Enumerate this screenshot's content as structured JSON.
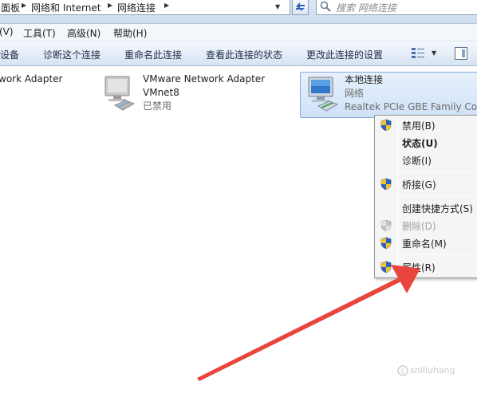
{
  "address_bar": {
    "crumbs": [
      "面板",
      "网络和 Internet",
      "网络连接"
    ],
    "search_placeholder": "搜索 网络连接"
  },
  "menu_bar": {
    "items": [
      "(V)",
      "工具(T)",
      "高级(N)",
      "帮助(H)"
    ]
  },
  "command_bar": {
    "items": [
      "设备",
      "诊断这个连接",
      "重命名此连接",
      "查看此连接的状态",
      "更改此连接的设置"
    ]
  },
  "adapters": [
    {
      "name": "work Adapter",
      "line2": "",
      "line3": ""
    },
    {
      "name": "VMware Network Adapter",
      "line2": "VMnet8",
      "line3": "已禁用"
    },
    {
      "name": "本地连接",
      "line2": "网络",
      "line3": "Realtek PCIe GBE Family Con"
    }
  ],
  "context_menu": {
    "items": [
      {
        "label": "禁用(B)",
        "icon": "shield-icon",
        "style": "normal"
      },
      {
        "label": "状态(U)",
        "icon": "",
        "style": "bold"
      },
      {
        "label": "诊断(I)",
        "icon": "",
        "style": "normal"
      },
      {
        "label": "桥接(G)",
        "icon": "shield-icon",
        "style": "normal"
      },
      {
        "label": "创建快捷方式(S)",
        "icon": "",
        "style": "normal"
      },
      {
        "label": "删除(D)",
        "icon": "shield-icon",
        "style": "disabled"
      },
      {
        "label": "重命名(M)",
        "icon": "shield-icon",
        "style": "normal"
      },
      {
        "label": "属性(R)",
        "icon": "shield-icon",
        "style": "normal"
      }
    ]
  },
  "annotation": {
    "color": "#e8453c"
  },
  "watermark": {
    "text": "shiliuhang"
  }
}
